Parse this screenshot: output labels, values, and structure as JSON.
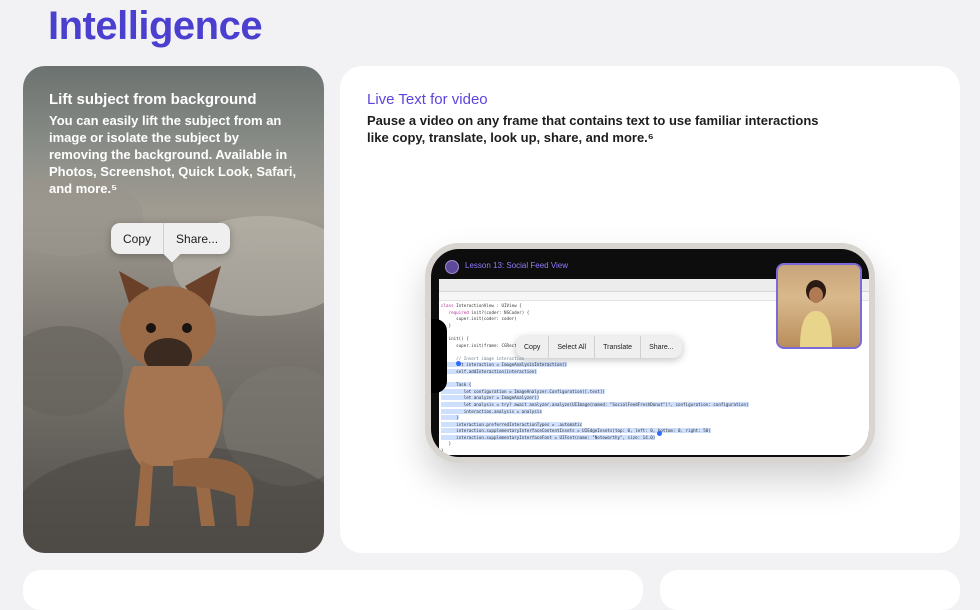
{
  "section": {
    "heading": "Intelligence"
  },
  "left_card": {
    "title": "Lift subject from background",
    "description": "You can easily lift the subject from an image or isolate the subject by removing the background. Available in Photos, Screenshot, Quick Look, Safari, and more.⁵",
    "menu": [
      "Copy",
      "Share..."
    ]
  },
  "right_card": {
    "title": "Live Text for video",
    "description": "Pause a video on any frame that contains text to use familiar interactions like copy, translate, look up, share, and more.⁶",
    "video_title": "Lesson 13: Social Feed View",
    "menu": [
      "Copy",
      "Select All",
      "Translate",
      "Share..."
    ]
  },
  "colors": {
    "heading": "#4b3fd0",
    "right_title": "#5d45db",
    "selection": "#cfe0ff",
    "handle": "#2c6dff"
  },
  "icons": [
    "app-logo-icon",
    "menu-tail"
  ]
}
